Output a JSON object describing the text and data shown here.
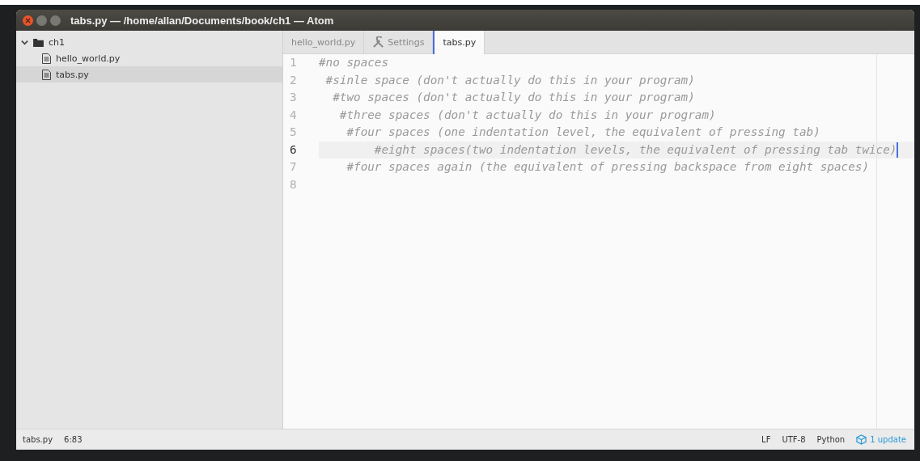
{
  "window": {
    "title": "tabs.py — /home/allan/Documents/book/ch1 — Atom"
  },
  "tree": {
    "root": {
      "label": "ch1",
      "expanded": true,
      "children": [
        {
          "label": "hello_world.py",
          "selected": false
        },
        {
          "label": "tabs.py",
          "selected": true
        }
      ]
    }
  },
  "tabs": [
    {
      "label": "hello_world.py",
      "kind": "file",
      "selected": false
    },
    {
      "label": "Settings",
      "kind": "settings",
      "selected": false
    },
    {
      "label": "tabs.py",
      "kind": "file",
      "selected": true
    }
  ],
  "editor": {
    "lines": [
      {
        "number": "1",
        "text": "#no spaces",
        "current": false
      },
      {
        "number": "2",
        "text": " #sinle space (don't actually do this in your program)",
        "current": false
      },
      {
        "number": "3",
        "text": "  #two spaces (don't actually do this in your program)",
        "current": false
      },
      {
        "number": "4",
        "text": "   #three spaces (don't actually do this in your program)",
        "current": false
      },
      {
        "number": "5",
        "text": "    #four spaces (one indentation level, the equivalent of pressing tab)",
        "current": false
      },
      {
        "number": "6",
        "text": "        #eight spaces(two indentation levels, the equivalent of pressing tab twice)",
        "current": true
      },
      {
        "number": "7",
        "text": "    #four spaces again (the equivalent of pressing backspace from eight spaces)",
        "current": false
      },
      {
        "number": "8",
        "current": false
      }
    ]
  },
  "status_bar": {
    "file": "tabs.py",
    "cursor": "6:83",
    "line_ending": "LF",
    "encoding": "UTF-8",
    "grammar": "Python",
    "update": "1 update"
  }
}
